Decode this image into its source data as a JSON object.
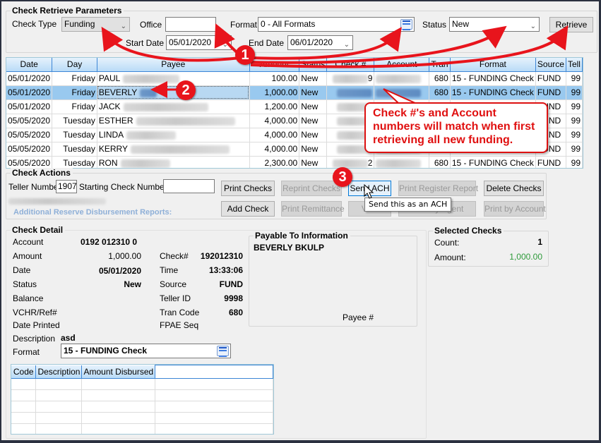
{
  "retrieve_params": {
    "title": "Check Retrieve Parameters",
    "check_type_label": "Check Type",
    "check_type_value": "Funding",
    "office_label": "Office",
    "office_value": "",
    "format_label": "Format",
    "format_value": "0 - All Formats",
    "status_label": "Status",
    "status_value": "New",
    "start_date_label": "Start Date",
    "start_date_value": "05/01/2020",
    "end_date_label": "End Date",
    "end_date_value": "06/01/2020",
    "retrieve_button": "Retrieve"
  },
  "checks_table": {
    "columns": [
      "Date",
      "Day",
      "Payee",
      "Amount",
      "Status",
      "Check #",
      "Account",
      "Tran",
      "Format",
      "Source",
      "Tell"
    ],
    "rows": [
      {
        "date": "05/01/2020",
        "day": "Friday",
        "payee": "PAUL",
        "amount": "100.00",
        "status": "New",
        "check_suffix": "9",
        "tran": "680",
        "format": "15 - FUNDING Check",
        "source": "FUND",
        "teller": "99"
      },
      {
        "date": "05/01/2020",
        "day": "Friday",
        "payee": "BEVERLY",
        "amount": "1,000.00",
        "status": "New",
        "check_suffix": "",
        "tran": "680",
        "format": "15 - FUNDING Check",
        "source": "FUND",
        "teller": "99",
        "selected": true
      },
      {
        "date": "05/01/2020",
        "day": "Friday",
        "payee": "JACK",
        "amount": "1,200.00",
        "status": "New",
        "check_suffix": "",
        "tran": "",
        "format": "",
        "source": "FUND",
        "teller": "99"
      },
      {
        "date": "05/05/2020",
        "day": "Tuesday",
        "payee": "ESTHER",
        "amount": "4,000.00",
        "status": "New",
        "check_suffix": "",
        "tran": "",
        "format": "",
        "source": "FUND",
        "teller": "99"
      },
      {
        "date": "05/05/2020",
        "day": "Tuesday",
        "payee": "LINDA",
        "amount": "4,000.00",
        "status": "New",
        "check_suffix": "",
        "tran": "",
        "format": "",
        "source": "FUND",
        "teller": "99"
      },
      {
        "date": "05/05/2020",
        "day": "Tuesday",
        "payee": "KERRY",
        "amount": "4,000.00",
        "status": "New",
        "check_suffix": "",
        "tran": "",
        "format": "",
        "source": "FUND",
        "teller": "99"
      },
      {
        "date": "05/05/2020",
        "day": "Tuesday",
        "payee": "RON",
        "amount": "2,300.00",
        "status": "New",
        "check_suffix": "2",
        "tran": "680",
        "format": "15 - FUNDING Check",
        "source": "FUND",
        "teller": "99"
      }
    ]
  },
  "check_actions": {
    "title": "Check Actions",
    "teller_number_label": "Teller Number",
    "teller_number_value": "1907",
    "starting_check_label": "Starting Check Number",
    "starting_check_value": "",
    "additional_reports_label": "Additional Reserve Disbursement Reports:",
    "buttons": {
      "print_checks": "Print Checks",
      "reprint_checks": "Reprint Checks",
      "send_ach": "Send ACH",
      "print_register_report": "Print Register Report",
      "delete_checks": "Delete Checks",
      "add_check": "Add Check",
      "print_remittance": "Print Remittance",
      "void": "Void",
      "print_by_agent": "Print by Agent",
      "print_by_account": "Print by Account"
    },
    "tooltip": "Send this as an ACH"
  },
  "check_detail": {
    "title": "Check Detail",
    "account_label": "Account",
    "account_value": "0192 012310 0",
    "amount_label": "Amount",
    "amount_value": "1,000.00",
    "date_label": "Date",
    "date_value": "05/01/2020",
    "status_label": "Status",
    "status_value": "New",
    "balance_label": "Balance",
    "balance_value": "",
    "vchr_label": "VCHR/Ref#",
    "vchr_value": "",
    "date_printed_label": "Date Printed",
    "date_printed_value": "",
    "description_label": "Description",
    "description_value": "asd",
    "format_label": "Format",
    "format_value": "15 - FUNDING Check",
    "check_no_label": "Check#",
    "check_no_value": "192012310",
    "time_label": "Time",
    "time_value": "13:33:06",
    "source_label": "Source",
    "source_value": "FUND",
    "teller_id_label": "Teller ID",
    "teller_id_value": "9998",
    "tran_code_label": "Tran Code",
    "tran_code_value": "680",
    "fpae_seq_label": "FPAE Seq",
    "fpae_seq_value": ""
  },
  "payable_to": {
    "title": "Payable To Information",
    "name": "BEVERLY BKULP",
    "payee_no_label": "Payee #"
  },
  "selected_checks": {
    "title": "Selected Checks",
    "count_label": "Count:",
    "count_value": "1",
    "amount_label": "Amount:",
    "amount_value": "1,000.00",
    "amount_color": "#2e9a3a"
  },
  "distribution_table": {
    "columns": [
      "Code",
      "Description",
      "Amount Disbursed",
      ""
    ],
    "empty_rows": 5
  },
  "annotations": {
    "marker_1": "1",
    "marker_2": "2",
    "marker_3": "3",
    "callout_text": "Check #'s and Account numbers will match when first retrieving all new funding.",
    "accent_color": "#e8141c"
  }
}
